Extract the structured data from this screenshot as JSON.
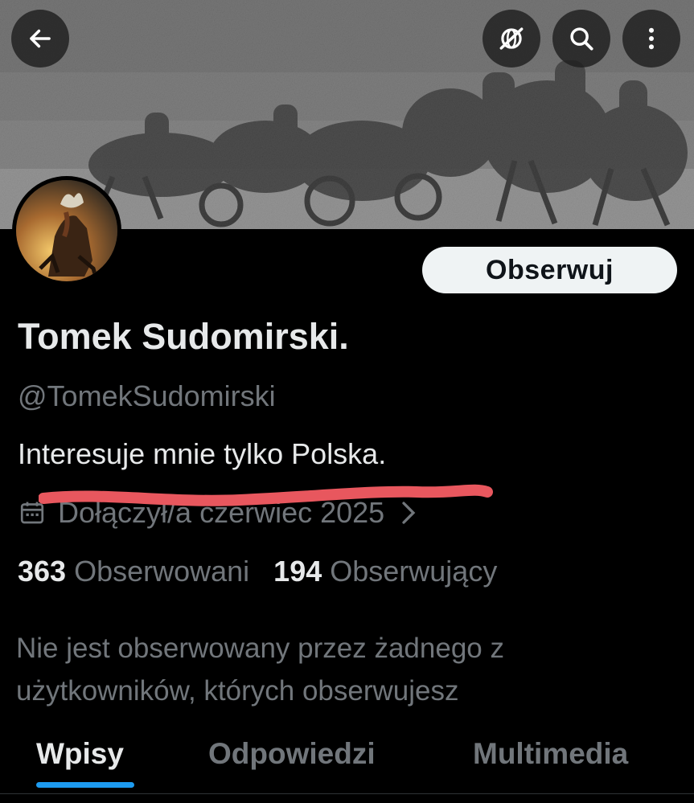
{
  "header": {
    "back_icon": "arrow-left-icon",
    "translate_icon": "slashed-globe-icon",
    "search_icon": "search-icon",
    "more_icon": "more-vertical-icon"
  },
  "profile": {
    "follow_label": "Obserwuj",
    "display_name": "Tomek Sudomirski.",
    "handle": "@TomekSudomirski",
    "bio": "Interesuje mnie tylko Polska.",
    "joined": "Dołączył/a czerwiec 2025",
    "following_count": "363",
    "following_label": "Obserwowani",
    "followers_count": "194",
    "followers_label": "Obserwujący",
    "followed_by_note": "Nie jest obserwowany przez żadnego z użytkowników, których obserwujesz"
  },
  "tabs": [
    {
      "label": "Wpisy",
      "active": true
    },
    {
      "label": "Odpowiedzi",
      "active": false
    },
    {
      "label": "Multimedia",
      "active": false
    }
  ],
  "colors": {
    "background": "#000000",
    "primary_text": "#e7e9ea",
    "secondary_text": "#71767b",
    "accent": "#1d9bf0",
    "annotation_red": "#e8575e"
  }
}
